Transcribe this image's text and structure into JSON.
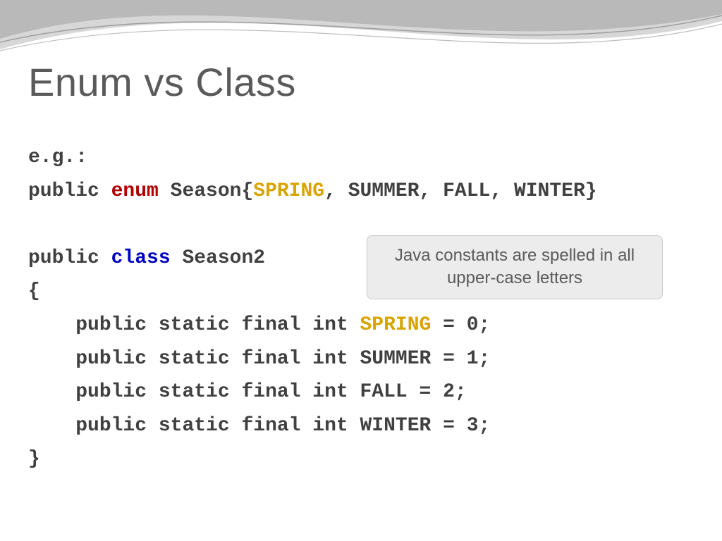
{
  "title": "Enum vs Class",
  "code": {
    "eg": "e.g.:",
    "line1_public": "public ",
    "line1_enum": "enum",
    "line1_season_open": " Season{",
    "line1_spring": "SPRING",
    "line1_rest": ", SUMMER, FALL, WINTER}",
    "line3_public": "public ",
    "line3_class": "class",
    "line3_rest": " Season2",
    "brace_open": "{",
    "indent": "    ",
    "psfi": "public static final int ",
    "spring": "SPRING",
    "spring_tail": " = 0;",
    "summer": "SUMMER = 1;",
    "fall": "FALL = 2;",
    "winter": "WINTER = 3;",
    "brace_close": "}"
  },
  "callout": "Java constants are spelled in all upper-case letters"
}
